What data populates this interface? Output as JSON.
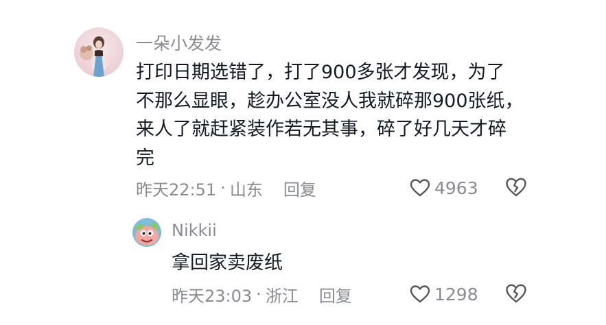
{
  "comments": [
    {
      "username": "一朵小发发",
      "content_lines": [
        "打印日期选错了，打了900多张才发现，为了",
        "不那么显眼，趁办公室没人我就碎那900张纸，",
        "来人了就赶紧装作若无其事，碎了好几天才碎",
        "完"
      ],
      "time": "昨天22:51",
      "separator": "·",
      "location": "山东",
      "reply_label": "回复",
      "likes": "4963",
      "like_icon": "heart-outline-icon",
      "dislike_icon": "broken-heart-icon"
    },
    {
      "username": "Nikkii",
      "content_lines": [
        "拿回家卖废纸"
      ],
      "time": "昨天23:03",
      "separator": "·",
      "location": "浙江",
      "reply_label": "回复",
      "likes": "1298",
      "like_icon": "heart-outline-icon",
      "dislike_icon": "broken-heart-icon"
    }
  ],
  "colors": {
    "text_primary": "#161823",
    "text_secondary": "#8a8b91",
    "background": "#ffffff"
  }
}
